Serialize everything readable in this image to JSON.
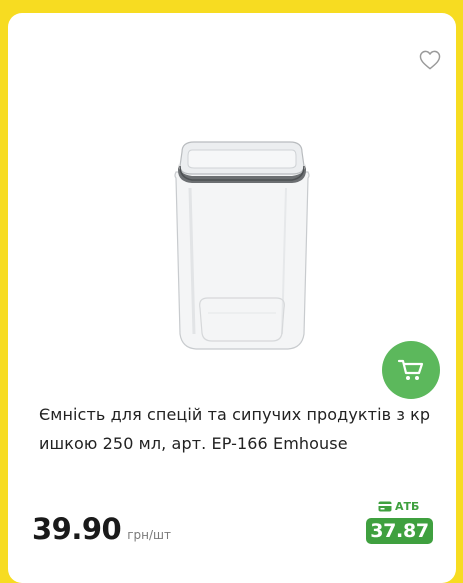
{
  "product": {
    "title": "Ємність для спецій та сипучих продуктів з кришкою 250 мл, арт. EP-166 Emhouse",
    "image_description": "transparent square storage container with grey-rimmed lid"
  },
  "price": {
    "value": "39.90",
    "unit": "грн/шт"
  },
  "atb_offer": {
    "label": "АТБ",
    "price": "37.87"
  },
  "icons": {
    "favorite": "heart-outline-icon",
    "cart": "cart-icon",
    "card": "card-icon"
  },
  "colors": {
    "background": "#f7dc21",
    "card": "#ffffff",
    "accent_green": "#5cb85c",
    "atb_green": "#3fa03f"
  }
}
